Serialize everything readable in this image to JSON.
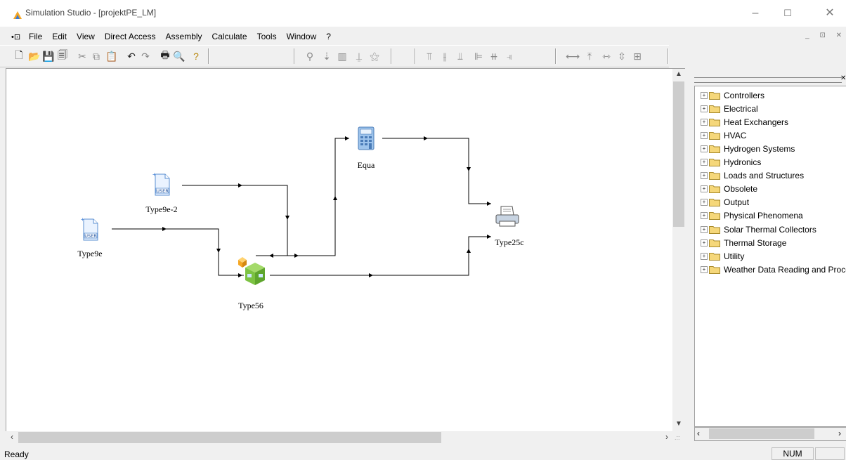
{
  "window": {
    "title": "Simulation Studio - [projektPE_LM]",
    "controls": [
      "–",
      "☐",
      "✕"
    ]
  },
  "menu": {
    "items": [
      "File",
      "Edit",
      "View",
      "Direct Access",
      "Assembly",
      "Calculate",
      "Tools",
      "Window",
      "?"
    ]
  },
  "canvas": {
    "components": [
      {
        "id": "type9e",
        "label": "Type9e",
        "icon": "user-data-reader-icon"
      },
      {
        "id": "type9e2",
        "label": "Type9e-2",
        "icon": "user-data-reader-icon"
      },
      {
        "id": "equa",
        "label": "Equa",
        "icon": "calculator-icon"
      },
      {
        "id": "type56",
        "label": "Type56",
        "icon": "building-cube-icon"
      },
      {
        "id": "type25c",
        "label": "Type25c",
        "icon": "printer-icon"
      }
    ],
    "user_badge": "USER"
  },
  "library": {
    "folders": [
      "Controllers",
      "Electrical",
      "Heat Exchangers",
      "HVAC",
      "Hydrogen Systems",
      "Hydronics",
      "Loads and Structures",
      "Obsolete",
      "Output",
      "Physical Phenomena",
      "Solar Thermal Collectors",
      "Thermal Storage",
      "Utility",
      "Weather Data Reading and Processing"
    ]
  },
  "status": {
    "text": "Ready",
    "num": "NUM"
  },
  "colors": {
    "folder": "#f5d77a",
    "cube_green": "#7cc242",
    "cube_orange": "#f5a623"
  }
}
